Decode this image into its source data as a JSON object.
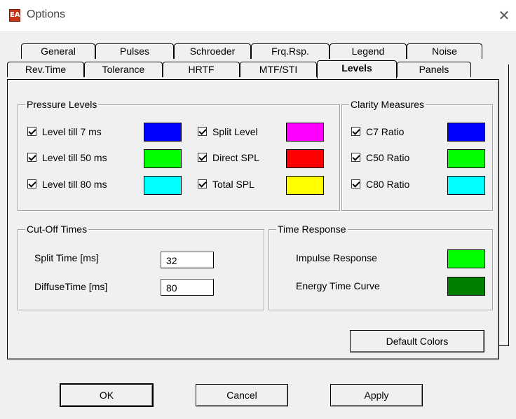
{
  "window": {
    "title": "Options",
    "icon_text": "EA",
    "close_glyph": "✕"
  },
  "tabs_row1": [
    {
      "label": "General"
    },
    {
      "label": "Pulses"
    },
    {
      "label": "Schroeder"
    },
    {
      "label": "Frq.Rsp."
    },
    {
      "label": "Legend"
    },
    {
      "label": "Noise"
    }
  ],
  "tabs_row2": [
    {
      "label": "Rev.Time"
    },
    {
      "label": "Tolerance"
    },
    {
      "label": "HRTF"
    },
    {
      "label": "MTF/STI"
    },
    {
      "label": "Levels",
      "active": true
    },
    {
      "label": "Panels"
    }
  ],
  "pressure_levels": {
    "title": "Pressure Levels",
    "items": [
      {
        "label": "Level till 7 ms",
        "checked": true,
        "color": "#0000ff"
      },
      {
        "label": "Level till 50 ms",
        "checked": true,
        "color": "#00ff00"
      },
      {
        "label": "Level till 80 ms",
        "checked": true,
        "color": "#00ffff"
      },
      {
        "label": "Split Level",
        "checked": true,
        "color": "#ff00ff"
      },
      {
        "label": "Direct SPL",
        "checked": true,
        "color": "#ff0000"
      },
      {
        "label": "Total SPL",
        "checked": true,
        "color": "#ffff00"
      }
    ]
  },
  "clarity_measures": {
    "title": "Clarity Measures",
    "items": [
      {
        "label": "C7 Ratio",
        "checked": true,
        "color": "#0000ff"
      },
      {
        "label": "C50 Ratio",
        "checked": true,
        "color": "#00ff00"
      },
      {
        "label": "C80 Ratio",
        "checked": true,
        "color": "#00ffff"
      }
    ]
  },
  "cutoff_times": {
    "title": "Cut-Off Times",
    "split_label": "Split Time [ms]",
    "split_value": "32",
    "diffuse_label": "DiffuseTime [ms]",
    "diffuse_value": "80"
  },
  "time_response": {
    "title": "Time Response",
    "items": [
      {
        "label": "Impulse Response",
        "color": "#00ff00"
      },
      {
        "label": "Energy Time Curve",
        "color": "#007f00"
      }
    ]
  },
  "buttons": {
    "default_colors": "Default Colors",
    "ok": "OK",
    "cancel": "Cancel",
    "apply": "Apply"
  }
}
